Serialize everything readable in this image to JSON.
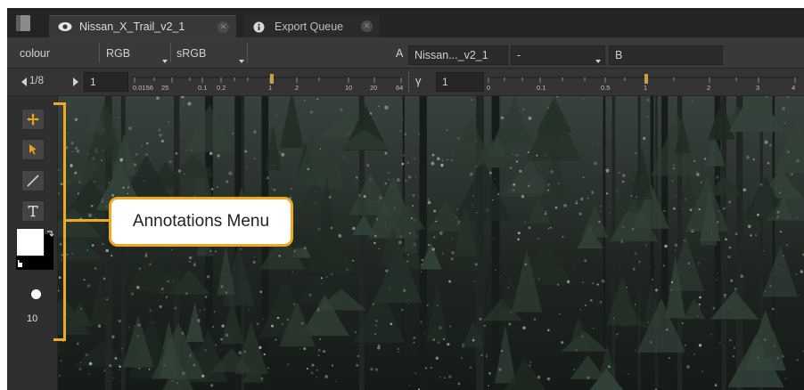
{
  "tabs": [
    {
      "label": "Nissan_X_Trail_v2_1",
      "icon": "eye-icon",
      "active": true
    },
    {
      "label": "Export Queue",
      "icon": "info-icon",
      "active": false
    }
  ],
  "toolbar1": {
    "channel_label": "colour",
    "colorspace": "RGB",
    "lut": "sRGB",
    "input_a_letter": "A",
    "input_a_value": "Nissan..._v2_1",
    "compare_mode": "-",
    "input_b_letter": "B",
    "input_b_value": ""
  },
  "toolbar2": {
    "frame_counter": "1/8",
    "gain_value": "1",
    "gain_ticks": [
      "0.0156",
      "25",
      "0.1",
      "0.2",
      "1",
      "2",
      "10",
      "20",
      "64"
    ],
    "gamma_label": "γ",
    "gamma_value": "1",
    "gamma_ticks": [
      "0",
      "0.1",
      "0.5",
      "1",
      "2",
      "3",
      "4"
    ]
  },
  "left_tools": {
    "brush_size": "10"
  },
  "annotation": {
    "callout_text": "Annotations Menu",
    "accent": "#f0a91c"
  }
}
